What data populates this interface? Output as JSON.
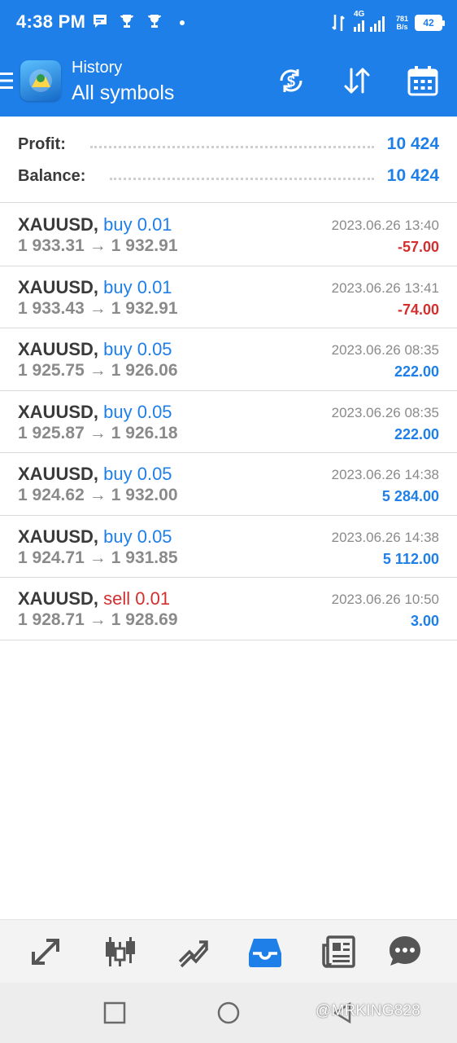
{
  "status_bar": {
    "time": "4:38 PM",
    "network": "4G",
    "speed_value": "781",
    "speed_unit": "B/s",
    "battery": "42",
    "icons": [
      "chat-notification-icon",
      "trophy-icon",
      "trophy-icon",
      "dot-icon",
      "vibrate-icon",
      "signal-icon",
      "signal-icon",
      "battery-icon"
    ]
  },
  "app_bar": {
    "title_small": "History",
    "title_big": "All symbols",
    "icons": [
      "menu-icon",
      "app-logo",
      "currency-exchange-icon",
      "sort-icon",
      "calendar-icon"
    ]
  },
  "summary": {
    "profit_label": "Profit:",
    "profit_value": "10 424",
    "balance_label": "Balance:",
    "balance_value": "10 424"
  },
  "deals": [
    {
      "symbol": "XAUUSD,",
      "side": "buy",
      "side_text": "buy 0.01",
      "open": "1 933.31",
      "arrow": "→",
      "close": "1 932.91",
      "time": "2023.06.26 13:40",
      "profit": "-57.00"
    },
    {
      "symbol": "XAUUSD,",
      "side": "buy",
      "side_text": "buy 0.01",
      "open": "1 933.43",
      "arrow": "→",
      "close": "1 932.91",
      "time": "2023.06.26 13:41",
      "profit": "-74.00"
    },
    {
      "symbol": "XAUUSD,",
      "side": "buy",
      "side_text": "buy 0.05",
      "open": "1 925.75",
      "arrow": "→",
      "close": "1 926.06",
      "time": "2023.06.26 08:35",
      "profit": "222.00"
    },
    {
      "symbol": "XAUUSD,",
      "side": "buy",
      "side_text": "buy 0.05",
      "open": "1 925.87",
      "arrow": "→",
      "close": "1 926.18",
      "time": "2023.06.26 08:35",
      "profit": "222.00"
    },
    {
      "symbol": "XAUUSD,",
      "side": "buy",
      "side_text": "buy 0.05",
      "open": "1 924.62",
      "arrow": "→",
      "close": "1 932.00",
      "time": "2023.06.26 14:38",
      "profit": "5 284.00"
    },
    {
      "symbol": "XAUUSD,",
      "side": "buy",
      "side_text": "buy 0.05",
      "open": "1 924.71",
      "arrow": "→",
      "close": "1 931.85",
      "time": "2023.06.26 14:38",
      "profit": "5 112.00"
    },
    {
      "symbol": "XAUUSD,",
      "side": "sell",
      "side_text": "sell 0.01",
      "open": "1 928.71",
      "arrow": "→",
      "close": "1 928.69",
      "time": "2023.06.26 10:50",
      "profit": "3.00"
    }
  ],
  "bottom_nav": {
    "items": [
      "quotes-arrows-icon",
      "chart-candles-icon",
      "trade-icon",
      "history-inbox-icon",
      "news-icon",
      "chat-icon"
    ],
    "active": "history-inbox-icon"
  },
  "system_nav": {
    "items": [
      "recents-square-icon",
      "home-circle-icon",
      "back-triangle-icon"
    ],
    "watermark": "@MRKING828"
  },
  "colors": {
    "accent": "#1f7fe8",
    "negative": "#d32f2f",
    "text_dark": "#3a3a3a",
    "text_gray": "#8a8a8a"
  }
}
